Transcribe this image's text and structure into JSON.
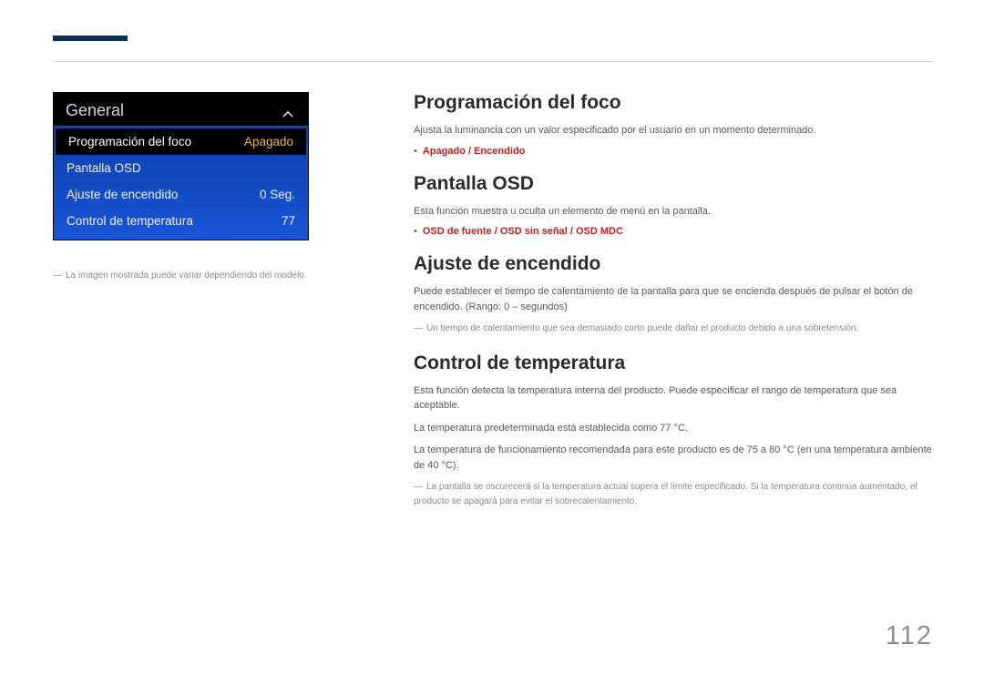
{
  "menu": {
    "title": "General",
    "rows": [
      {
        "label": "Programación del foco",
        "value": "Apagado",
        "selected": true
      },
      {
        "label": "Pantalla OSD",
        "value": "",
        "selected": false
      },
      {
        "label": "Ajuste de encendido",
        "value": "0 Seg.",
        "selected": false
      },
      {
        "label": "Control de temperatura",
        "value": "77",
        "selected": false
      }
    ]
  },
  "caption": "La imagen mostrada puede variar dependiendo del modelo.",
  "sections": {
    "focus": {
      "heading": "Programación del foco",
      "desc": "Ajusta la luminancia con un valor especificado por el usuario en un momento determinado.",
      "options": "Apagado / Encendido"
    },
    "osd": {
      "heading": "Pantalla OSD",
      "desc": "Esta función muestra u oculta un elemento de menú en la pantalla.",
      "options": "OSD de fuente / OSD sin señal / OSD MDC"
    },
    "power": {
      "heading": "Ajuste de encendido",
      "desc": "Puede establecer el tiempo de calentamiento de la pantalla para que se encienda después de pulsar el botón de encendido. (Rango: 0 – segundos)",
      "note": "Un tiempo de calentamiento que sea demasiado corto puede dañar el producto debido a una sobretensión."
    },
    "temp": {
      "heading": "Control de temperatura",
      "line1": "Esta función detecta la temperatura interna del producto. Puede especificar el rango de temperatura que sea aceptable.",
      "line2": "La temperatura predeterminada está establecida como 77 °C.",
      "line3": "La temperatura de funcionamiento recomendada para este producto es de 75 a 80 °C (en una temperatura ambiente de 40 °C).",
      "note": "La pantalla se oscurecerá si la temperatura actual supera el límite especificado. Si la temperatura continúa aumentado, el producto se apagará para evitar el sobrecalentamiento."
    }
  },
  "page_number": "112"
}
